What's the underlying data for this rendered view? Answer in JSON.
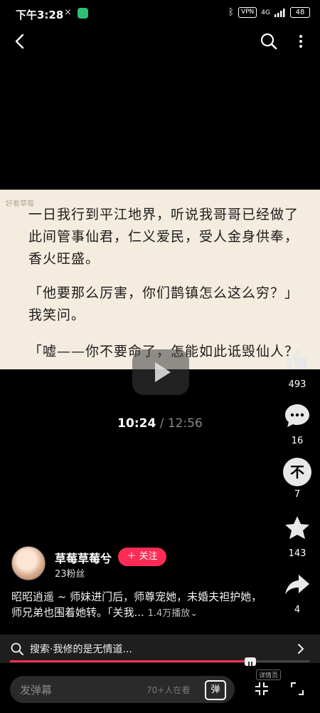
{
  "status_bar": {
    "time": "下午3:28",
    "x_icon": "×",
    "vpn": "VPN",
    "network": "4G",
    "battery": "48"
  },
  "video": {
    "watermark": "好看草莓",
    "paragraphs": [
      "一日我行到平江地界，听说我哥哥已经做了此间管事仙君，仁义爱民，受人金身供奉，香火旺盛。",
      "「他要那么厉害，你们鹊镇怎么这么穷？」我笑问。",
      "「嘘——你不要命了，怎能如此诋毁仙人？"
    ],
    "current_time": "10:24",
    "separator": "/",
    "total_time": "12:56",
    "progress": 0.811
  },
  "actions": {
    "like_count": "493",
    "comment_count": "16",
    "not_interested_count": "7",
    "favorite_count": "143",
    "share_count": "4",
    "not_interested_glyph": "不"
  },
  "author": {
    "name": "草莓草莓兮",
    "fans": "23粉丝",
    "follow_label": "＋ 关注"
  },
  "description": {
    "text": "昭昭逍遥 ~ 师妹进门后，师尊宠她，未婚夫袒护她，师兄弟也围着她转。「关我...",
    "plays": "1.4万播放"
  },
  "search_bar": {
    "text": "搜索·我修的是无情道..."
  },
  "detail_tag": "详情页",
  "danmu": {
    "placeholder": "发弹幕",
    "online": "70+人在看",
    "button": "弹"
  },
  "colors": {
    "accent": "#fe2c55",
    "frame_bg": "#f4ecdf"
  }
}
